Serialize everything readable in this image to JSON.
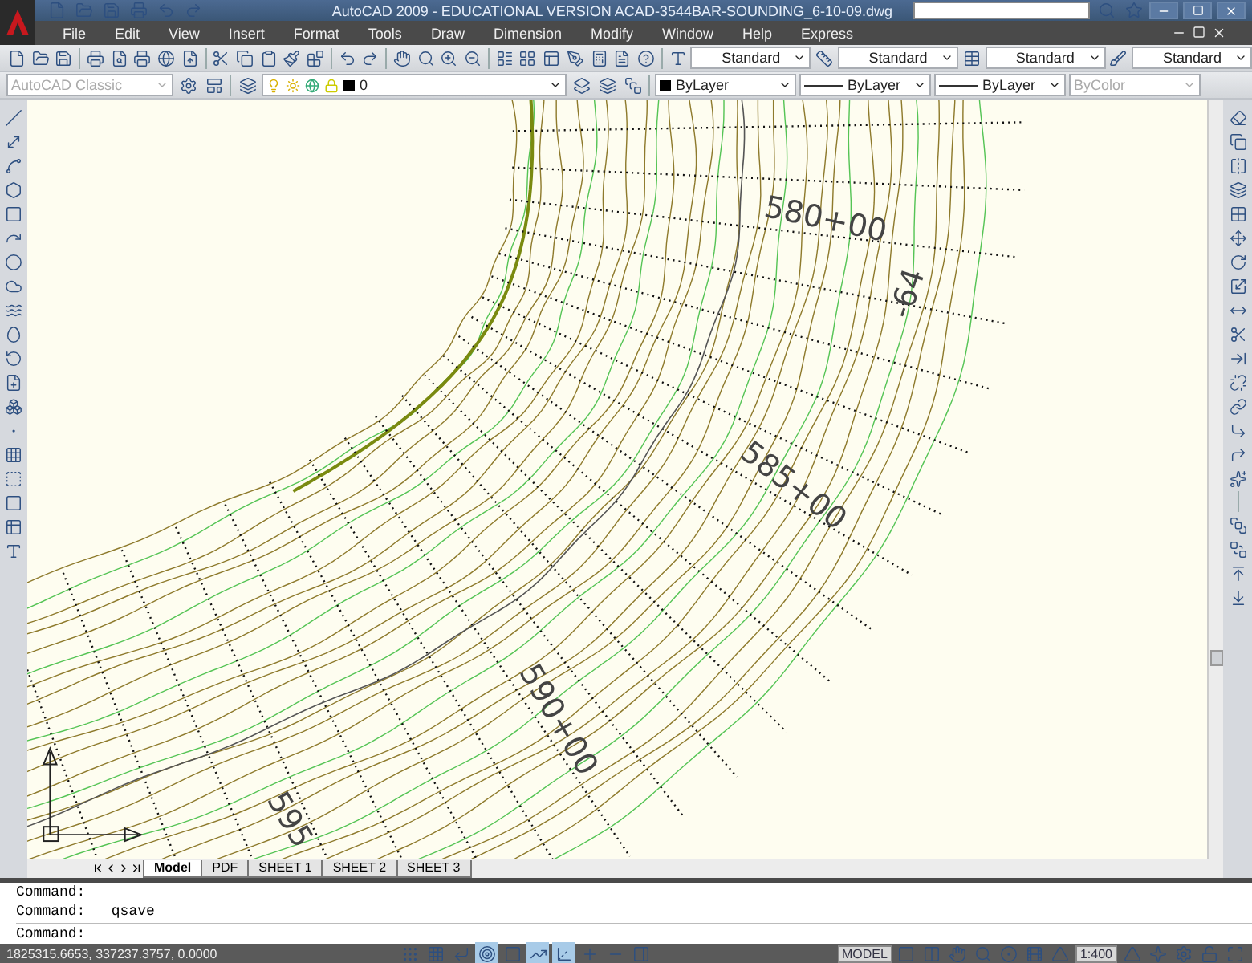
{
  "window": {
    "title": "AutoCAD 2009 - EDUCATIONAL VERSION ACAD-3544BAR-SOUNDING_6-10-09.dwg"
  },
  "menu": [
    "File",
    "Edit",
    "View",
    "Insert",
    "Format",
    "Tools",
    "Draw",
    "Dimension",
    "Modify",
    "Window",
    "Help",
    "Express"
  ],
  "styles_toolbar": [
    {
      "value": "Standard"
    },
    {
      "value": "Standard"
    },
    {
      "value": "Standard"
    },
    {
      "value": "Standard"
    }
  ],
  "workspace": {
    "value": "AutoCAD Classic"
  },
  "layer": {
    "value": "0"
  },
  "properties": [
    {
      "kind": "color",
      "value": "ByLayer",
      "disabled": false
    },
    {
      "kind": "line",
      "value": "ByLayer",
      "disabled": false
    },
    {
      "kind": "line",
      "value": "ByLayer",
      "disabled": false
    },
    {
      "kind": "plain",
      "value": "ByColor",
      "disabled": true
    }
  ],
  "drawing": {
    "labels": [
      "580+00",
      "-64",
      "585+00",
      "590+00",
      "595"
    ]
  },
  "layout_tabs": [
    {
      "label": "Model",
      "selected": true
    },
    {
      "label": "PDF",
      "selected": false
    },
    {
      "label": "SHEET 1",
      "selected": false
    },
    {
      "label": "SHEET 2",
      "selected": false
    },
    {
      "label": "SHEET 3",
      "selected": false
    }
  ],
  "command_history": [
    "Command:",
    "Command:  _qsave"
  ],
  "command_prompt": "Command:",
  "status_bar": {
    "coordinates": "1825315.6653, 337237.3757, 0.0000",
    "toggles": [
      {
        "on": false
      },
      {
        "on": false
      },
      {
        "on": false
      },
      {
        "on": true
      },
      {
        "on": false
      },
      {
        "on": true
      },
      {
        "on": true
      },
      {
        "on": false
      },
      {
        "on": false
      },
      {
        "on": false
      }
    ],
    "space": "MODEL",
    "scale": "1:400"
  }
}
